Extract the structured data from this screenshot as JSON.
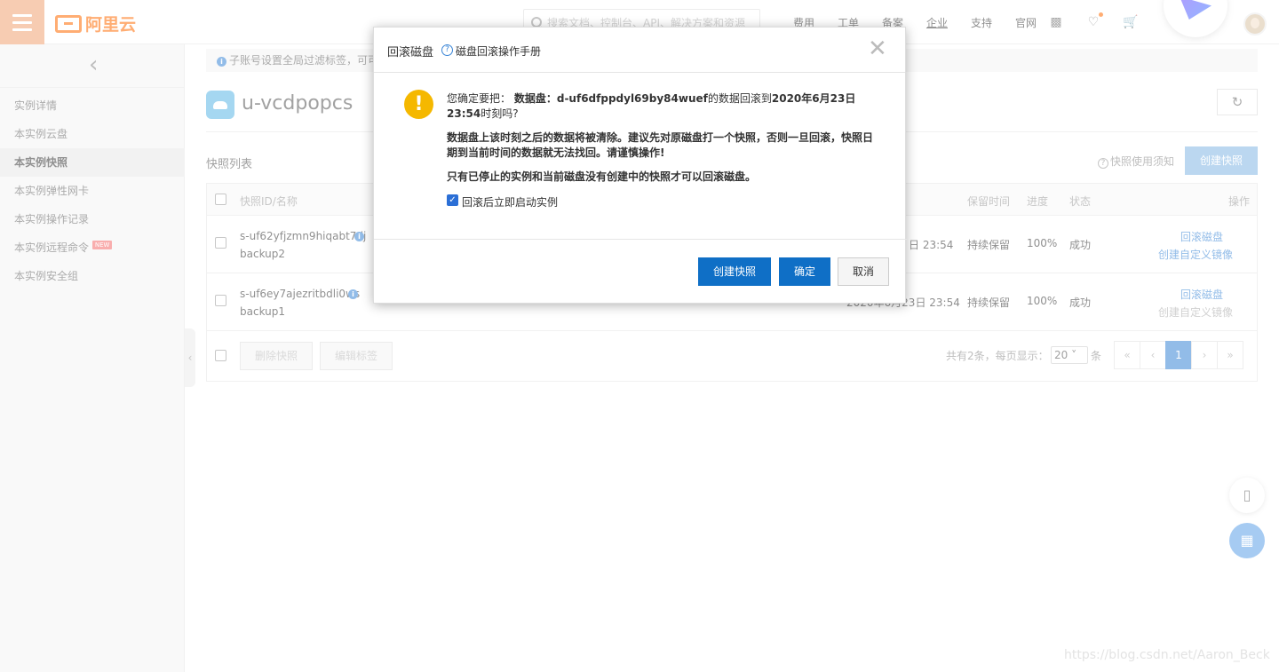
{
  "header": {
    "logo_text": "阿里云",
    "search_placeholder": "搜索文档、控制台、API、解决方案和资源",
    "nav": [
      "费用",
      "工单",
      "备案",
      "企业",
      "支持",
      "官网"
    ]
  },
  "sidebar": {
    "items": [
      {
        "label": "实例详情",
        "active": false
      },
      {
        "label": "本实例云盘",
        "active": false
      },
      {
        "label": "本实例快照",
        "active": true
      },
      {
        "label": "本实例弹性网卡",
        "active": false
      },
      {
        "label": "本实例操作记录",
        "active": false
      },
      {
        "label": "本实例远程命令",
        "active": false,
        "badge": "NEW"
      },
      {
        "label": "本实例安全组",
        "active": false
      }
    ]
  },
  "main": {
    "notice": "子账号设置全局过滤标签，可可",
    "instance_name": "u-vcdpopcs",
    "section_title": "快照列表",
    "usage_link": "快照使用须知",
    "create_button": "创建快照",
    "table": {
      "headers": {
        "id_name": "快照ID/名称",
        "retention": "保留时间",
        "progress": "进度",
        "status": "状态",
        "actions": "操作"
      },
      "rows": [
        {
          "id": "s-uf62yfjzmn9hiqabt7dj",
          "name": "backup2",
          "time_partial": "日 23:54",
          "retention": "持续保留",
          "progress": "100%",
          "status": "成功",
          "action_rollback": "回滚磁盘",
          "action_image": "创建自定义镜像"
        },
        {
          "id": "s-uf6ey7ajezritbdli0ws",
          "name": "backup1",
          "time_partial": "2020年6月23日 23:54",
          "retention": "持续保留",
          "progress": "100%",
          "status": "成功",
          "action_rollback": "回滚磁盘",
          "action_image": "创建自定义镜像"
        }
      ],
      "footer": {
        "delete_button": "删除快照",
        "edit_tags_button": "编辑标签",
        "total_text": "共有2条，每页显示：",
        "page_size": "20",
        "page_unit": "条",
        "pages": [
          "«",
          "‹",
          "1",
          "›",
          "»"
        ],
        "current_page": "1"
      }
    }
  },
  "dialog": {
    "title": "回滚磁盘",
    "manual_link": "磁盘回滚操作手册",
    "confirm_prefix": "您确定要把：",
    "disk_label": "数据盘：",
    "disk_id": "d-uf6dfppdyl69by84wuef",
    "confirm_mid": "的数据回滚到",
    "rollback_time": "2020年6月23日 23:54",
    "confirm_suffix": "时刻吗?",
    "warning": "数据盘上该时刻之后的数据将被清除。建议先对原磁盘打一个快照，否则一旦回滚，快照日期到当前时间的数据就无法找回。请谨慎操作!",
    "note": "只有已停止的实例和当前磁盘没有创建中的快照才可以回滚磁盘。",
    "checkbox_label": "回滚后立即启动实例",
    "checkbox_checked": true,
    "btn_create_snapshot": "创建快照",
    "btn_confirm": "确定",
    "btn_cancel": "取消"
  },
  "watermark": "https://blog.csdn.net/Aaron_Beck",
  "colors": {
    "brand_orange": "#ff6a00",
    "primary_blue": "#0f6fc6",
    "link_blue": "#3a85d6",
    "warning_yellow": "#f5b800"
  }
}
